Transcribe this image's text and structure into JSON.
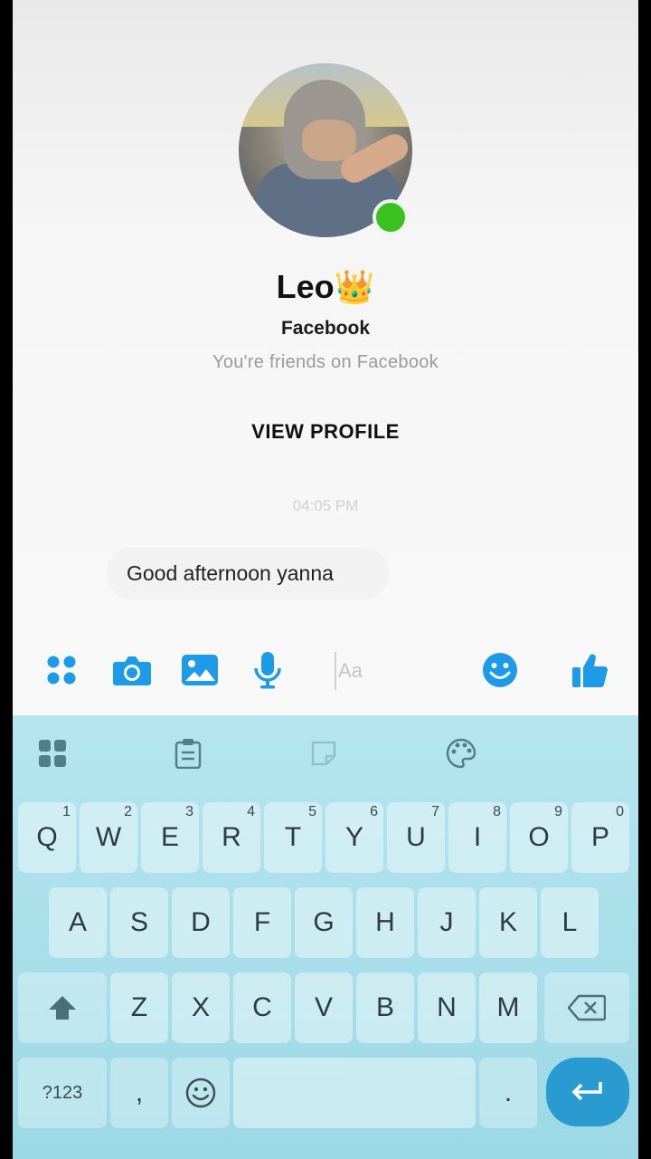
{
  "profile": {
    "name": "Leo👑",
    "platform": "Facebook",
    "relationship": "You're friends on Facebook",
    "view_profile_label": "VIEW PROFILE",
    "online": true
  },
  "conversation": {
    "timestamp": "04:05 PM",
    "messages": [
      {
        "text": "Good afternoon yanna",
        "direction": "outgoing-draft"
      }
    ]
  },
  "composer": {
    "placeholder": "Aa",
    "icons": [
      "apps-icon",
      "camera-icon",
      "gallery-icon",
      "microphone-icon",
      "emoji-icon",
      "thumbs-up-icon"
    ],
    "accent_color": "#1e9be8"
  },
  "keyboard": {
    "toolbar_icons": [
      "grid-icon",
      "clipboard-icon",
      "sticker-icon",
      "palette-icon"
    ],
    "row1": [
      {
        "k": "Q",
        "h": "1"
      },
      {
        "k": "W",
        "h": "2"
      },
      {
        "k": "E",
        "h": "3"
      },
      {
        "k": "R",
        "h": "4"
      },
      {
        "k": "T",
        "h": "5"
      },
      {
        "k": "Y",
        "h": "6"
      },
      {
        "k": "U",
        "h": "7"
      },
      {
        "k": "I",
        "h": "8"
      },
      {
        "k": "O",
        "h": "9"
      },
      {
        "k": "P",
        "h": "0"
      }
    ],
    "row2": [
      "A",
      "S",
      "D",
      "F",
      "G",
      "H",
      "J",
      "K",
      "L"
    ],
    "row3": [
      "Z",
      "X",
      "C",
      "V",
      "B",
      "N",
      "M"
    ],
    "symbols_label": "?123",
    "comma_label": ",",
    "period_label": ".",
    "background_color": "#a9dfea",
    "enter_color": "#2a9bd1"
  }
}
